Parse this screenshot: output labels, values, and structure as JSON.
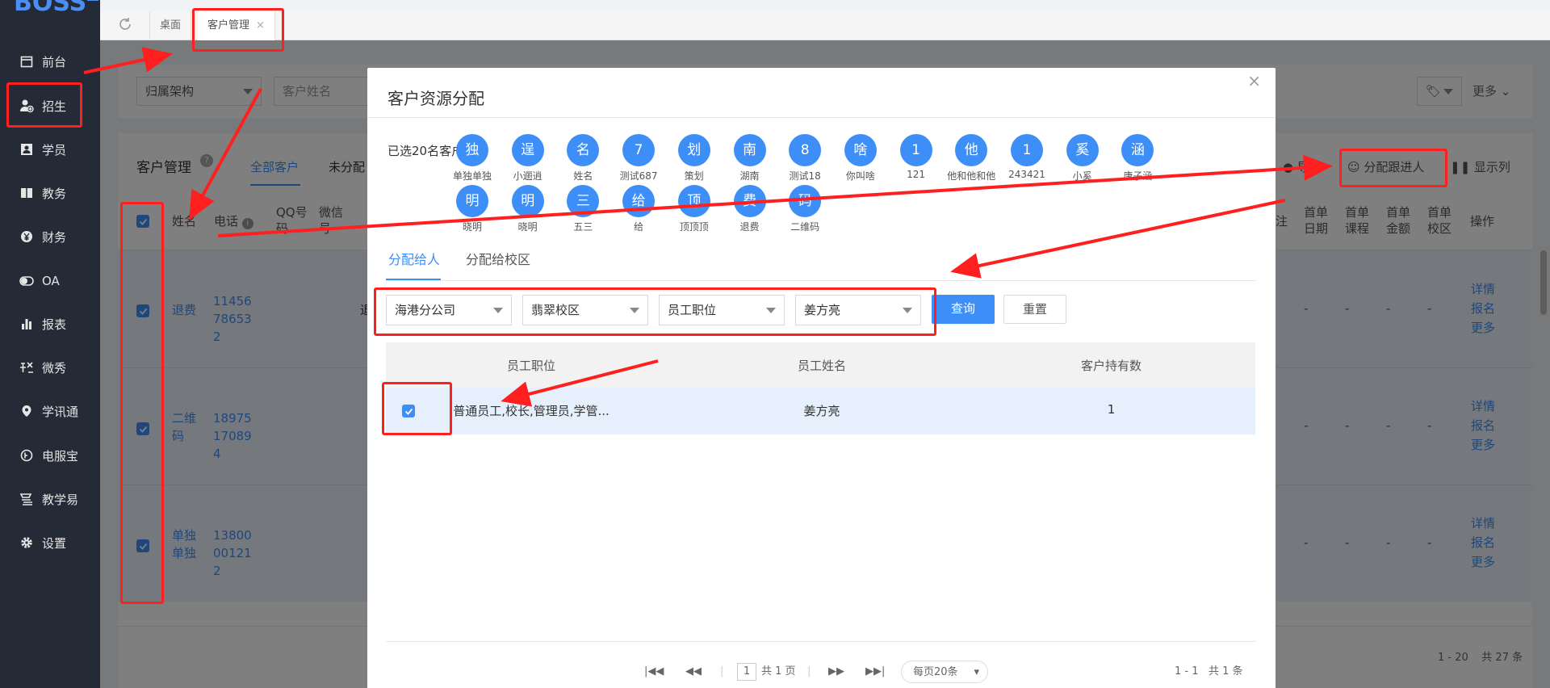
{
  "logo": {
    "text": "BOSS",
    "badge": "云"
  },
  "sidebar": {
    "items": [
      {
        "label": "前台",
        "icon": "calendar-icon"
      },
      {
        "label": "招生",
        "icon": "user-add-icon"
      },
      {
        "label": "学员",
        "icon": "id-card-icon"
      },
      {
        "label": "教务",
        "icon": "book-icon"
      },
      {
        "label": "财务",
        "icon": "yen-icon"
      },
      {
        "label": "OA",
        "icon": "toggle-icon"
      },
      {
        "label": "报表",
        "icon": "bar-chart-icon"
      },
      {
        "label": "微秀",
        "icon": "xiu-icon"
      },
      {
        "label": "学讯通",
        "icon": "location-icon"
      },
      {
        "label": "电服宝",
        "icon": "phone-icon"
      },
      {
        "label": "教学易",
        "icon": "teaching-icon"
      },
      {
        "label": "设置",
        "icon": "gear-icon"
      }
    ]
  },
  "tabs": [
    {
      "label": "桌面"
    },
    {
      "label": "客户管理",
      "close": "×"
    }
  ],
  "filters": {
    "org": "归属架构",
    "name_placeholder": "客户姓名",
    "more": "更多"
  },
  "page": {
    "title": "客户管理",
    "tab_all": "全部客户",
    "tab_unassigned": "未分配",
    "export": "导出",
    "assign_follow": "分配跟进人",
    "show_cols": "显示列"
  },
  "table": {
    "headers": {
      "name": "姓名",
      "phone": "电话",
      "qq": "QQ号码",
      "wechat": "微信号",
      "remark": "注",
      "first_date": "首单日期",
      "first_course": "首单课程",
      "first_amount": "首单金额",
      "first_campus": "首单校区",
      "op": "操作"
    },
    "rows": [
      {
        "name": "退费",
        "phone": "11456786532",
        "extra": "退"
      },
      {
        "name": "二维码",
        "phone": "18975170894",
        "extra": ""
      },
      {
        "name": "单独单独",
        "phone": "13800001212",
        "extra": ""
      }
    ],
    "ops": [
      "详情",
      "报名",
      "更多"
    ],
    "dash": "-",
    "footer": "1 - 20    共 27 条"
  },
  "modal": {
    "title": "客户资源分配",
    "close": "×",
    "selected_label": "已选20名客户",
    "chips": [
      {
        "c": "独",
        "n": "单独单独"
      },
      {
        "c": "逞",
        "n": "小逦逍"
      },
      {
        "c": "名",
        "n": "姓名"
      },
      {
        "c": "7",
        "n": "测试687"
      },
      {
        "c": "划",
        "n": "策划"
      },
      {
        "c": "南",
        "n": "湖南"
      },
      {
        "c": "8",
        "n": "测试18"
      },
      {
        "c": "啥",
        "n": "你叫啥"
      },
      {
        "c": "1",
        "n": "121"
      },
      {
        "c": "他",
        "n": "他和他和他"
      },
      {
        "c": "1",
        "n": "243421"
      },
      {
        "c": "奚",
        "n": "小奚"
      },
      {
        "c": "涵",
        "n": "唐子涵"
      },
      {
        "c": "明",
        "n": "晓明"
      },
      {
        "c": "明",
        "n": "晓明"
      },
      {
        "c": "三",
        "n": "五三"
      },
      {
        "c": "给",
        "n": "给"
      },
      {
        "c": "顶",
        "n": "顶顶顶"
      },
      {
        "c": "费",
        "n": "退费"
      },
      {
        "c": "码",
        "n": "二维码"
      }
    ],
    "tab_person": "分配给人",
    "tab_campus": "分配给校区",
    "selects": [
      "海港分公司",
      "翡翠校区",
      "员工职位",
      "姜方亮"
    ],
    "query": "查询",
    "reset": "重置",
    "thead": {
      "position": "员工职位",
      "name": "员工姓名",
      "count": "客户持有数"
    },
    "row": {
      "position": "普通员工,校长,管理员,学管...",
      "name": "姜方亮",
      "count": "1"
    },
    "pager": {
      "page": "1",
      "total_pages": "共 1 页",
      "page_size": "每页20条",
      "range": "1 - 1",
      "total": "共 1 条"
    }
  },
  "colors": {
    "accent": "#3e8ef7",
    "sidebar": "#242b36",
    "annotation": "#ff1f1f"
  }
}
